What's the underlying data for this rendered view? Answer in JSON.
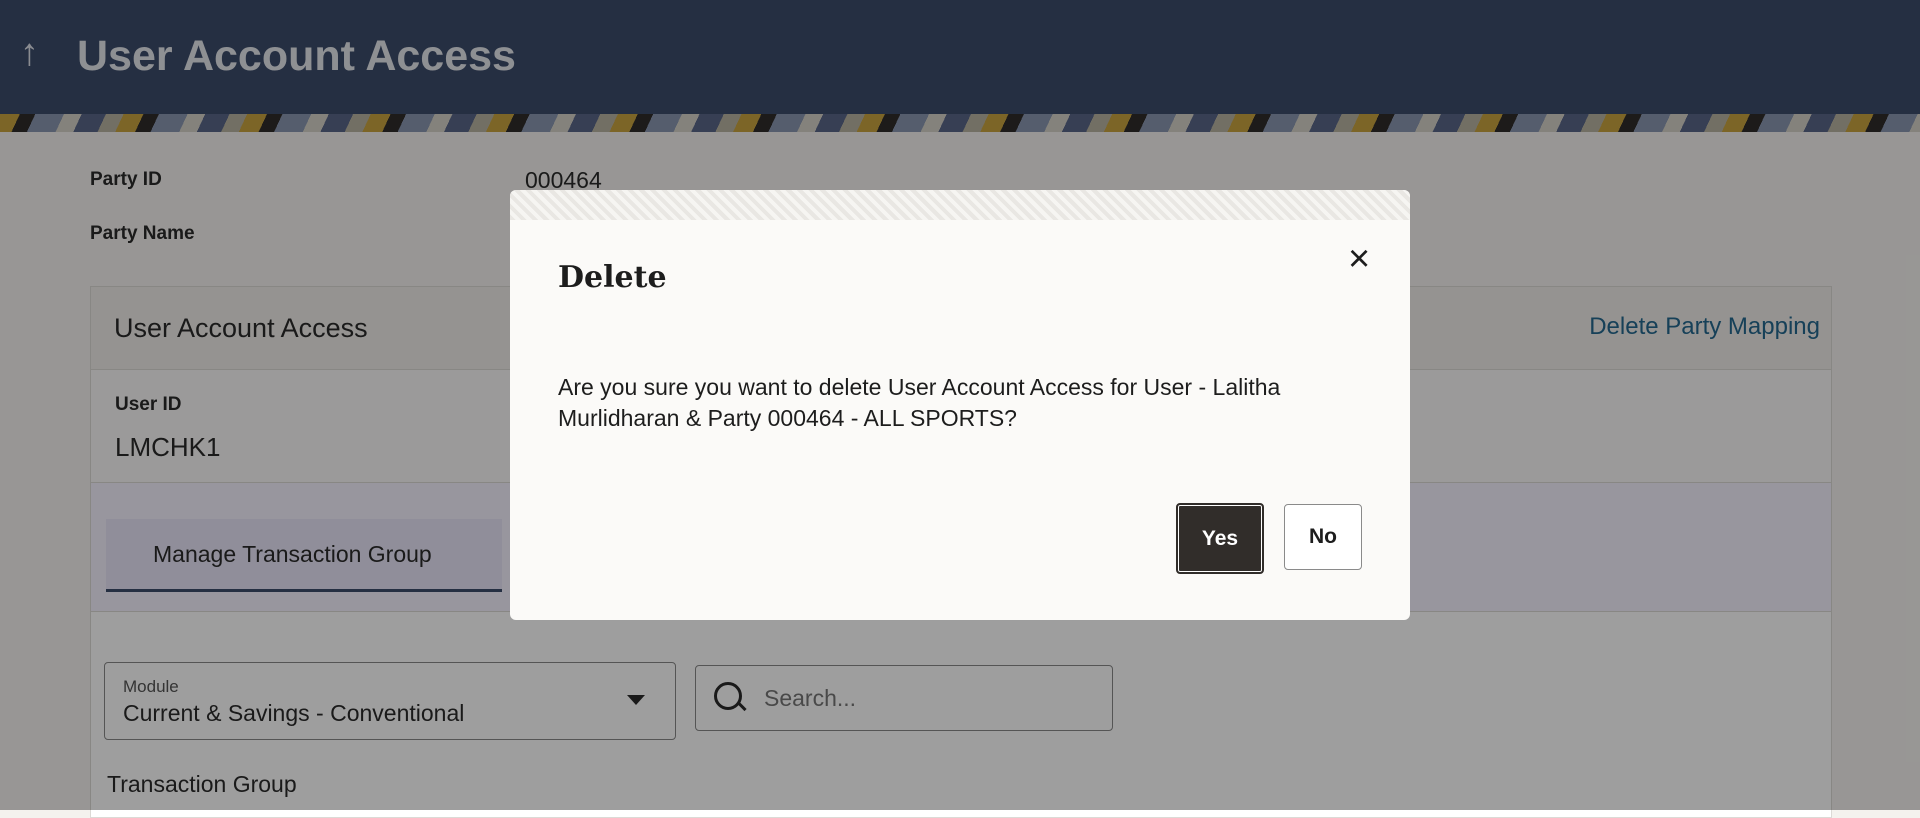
{
  "header": {
    "back_icon": "↑",
    "title": "User Account Access"
  },
  "party": {
    "id_label": "Party ID",
    "id_value": "000464",
    "name_label": "Party Name"
  },
  "card": {
    "title": "User Account Access",
    "delete_link": "Delete Party Mapping",
    "user_id_label": "User ID",
    "user_id_value": "LMCHK1",
    "tab_label": "Manage Transaction Group",
    "module_label": "Module",
    "module_value": "Current & Savings - Conventional",
    "search_placeholder": "Search...",
    "transaction_group_label": "Transaction Group"
  },
  "modal": {
    "title": "Delete",
    "close_icon": "×",
    "message": "Are you sure you want to delete User Account Access for User - Lalitha Murlidharan & Party 000464 - ALL SPORTS?",
    "yes_label": "Yes",
    "no_label": "No"
  },
  "colors": {
    "header": "#3d4c6b",
    "link": "#24688f",
    "primary_button": "#312d2a"
  }
}
